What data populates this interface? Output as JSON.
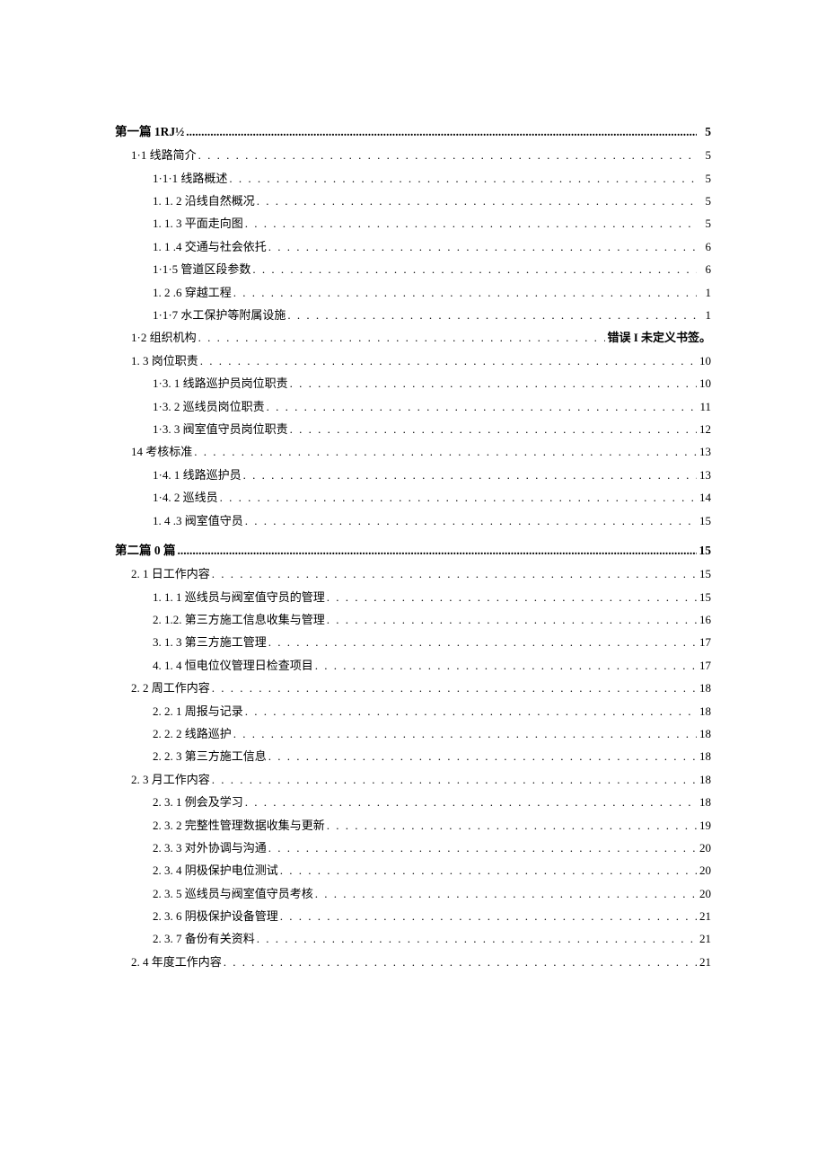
{
  "toc": [
    {
      "level": "h1",
      "label": "第一篇 1RJ½",
      "page": "5",
      "first": true
    },
    {
      "level": "h2",
      "label": "1·1 线路简介",
      "page": "5"
    },
    {
      "level": "h3",
      "label": "1·1·1 线路概述",
      "page": "5"
    },
    {
      "level": "h3",
      "label": "1. 1. 2 沿线自然概况",
      "page": "5"
    },
    {
      "level": "h3",
      "label": "1. 1. 3 平面走向图",
      "page": "5"
    },
    {
      "level": "h3",
      "label": "1. 1   .4 交通与社会依托",
      "page": "6"
    },
    {
      "level": "h3",
      "label": "1·1·5 管道区段参数",
      "page": "6"
    },
    {
      "level": "h3",
      "label": "1. 2   .6 穿越工程",
      "page": "1"
    },
    {
      "level": "h3",
      "label": "1·1·7 水工保护等附属设施",
      "page": "1"
    },
    {
      "level": "h2",
      "label": "1·2 组织机构",
      "page_text": "错误 I 未定义书签。",
      "err": true
    },
    {
      "level": "h2",
      "label": "1. 3   岗位职责",
      "page": "10"
    },
    {
      "level": "h3",
      "label": "1·3. 1 线路巡护员岗位职责",
      "page": "10"
    },
    {
      "level": "h3",
      "label": "1·3. 2 巡线员岗位职责",
      "page": "11"
    },
    {
      "level": "h3",
      "label": "1·3. 3 阀室值守员岗位职责",
      "page": "12"
    },
    {
      "level": "h2",
      "label": "14 考核标准",
      "page": "13"
    },
    {
      "level": "h3",
      "label": "1·4. 1 线路巡护员",
      "page": "13"
    },
    {
      "level": "h3",
      "label": "1·4. 2 巡线员",
      "page": "14"
    },
    {
      "level": "h3",
      "label": "1. 4   .3 阀室值守员",
      "page": "15"
    },
    {
      "level": "h1",
      "label": "第二篇 0 篇",
      "page": "15"
    },
    {
      "level": "h2",
      "label": "2. 1   日工作内容",
      "page": "15"
    },
    {
      "level": "h4",
      "label": "1.    1. 1 巡线员与阀室值守员的管理",
      "page": "15"
    },
    {
      "level": "h4",
      "label": "2.    1.2. 第三方施工信息收集与管理",
      "page": "16"
    },
    {
      "level": "h4",
      "label": "3.    1. 3 第三方施工管理",
      "page": "17"
    },
    {
      "level": "h4",
      "label": "4.    1. 4 恒电位仪管理日检查项目",
      "page": "17"
    },
    {
      "level": "h2",
      "label": "2. 2   周工作内容",
      "page": "18"
    },
    {
      "level": "h3",
      "label": "2. 2. 1 周报与记录",
      "page": "18"
    },
    {
      "level": "h3",
      "label": "2. 2. 2 线路巡护",
      "page": "18"
    },
    {
      "level": "h3",
      "label": "2. 2. 3 第三方施工信息",
      "page": "18"
    },
    {
      "level": "h2",
      "label": "2. 3 月工作内容",
      "page": "18"
    },
    {
      "level": "h3",
      "label": "2. 3. 1 例会及学习",
      "page": "18"
    },
    {
      "level": "h3",
      "label": "2. 3. 2 完整性管理数据收集与更新",
      "page": "19"
    },
    {
      "level": "h3",
      "label": "2. 3. 3 对外协调与沟通",
      "page": "20"
    },
    {
      "level": "h3",
      "label": "2. 3. 4 阴极保护电位测试",
      "page": "20"
    },
    {
      "level": "h3",
      "label": "2. 3. 5 巡线员与阀室值守员考核",
      "page": "20"
    },
    {
      "level": "h3",
      "label": "2. 3. 6 阴极保护设备管理",
      "page": "21"
    },
    {
      "level": "h3",
      "label": "2. 3. 7 备份有关资料",
      "page": "21"
    },
    {
      "level": "h2",
      "label": "2. 4 年度工作内容",
      "page": "21"
    }
  ]
}
